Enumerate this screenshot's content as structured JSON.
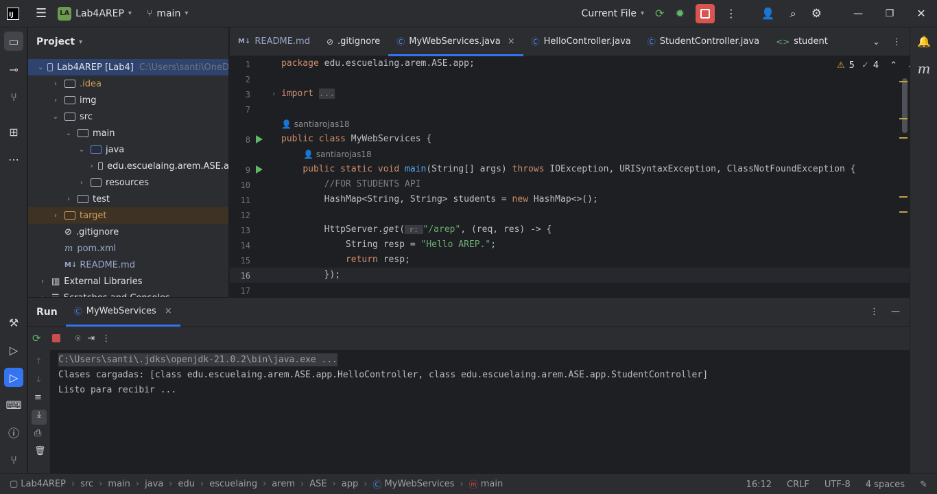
{
  "titlebar": {
    "logo_text": "IJ",
    "project_badge": "LA",
    "project_name": "Lab4AREP",
    "branch": "main",
    "run_config": "Current File"
  },
  "project_panel": {
    "title": "Project",
    "items": [
      {
        "label": "Lab4AREP [Lab4]",
        "path": "C:\\Users\\santi\\OneD",
        "indent": 0,
        "arrow": "down",
        "kind": "module",
        "selected": true
      },
      {
        "label": ".idea",
        "indent": 1,
        "arrow": "right",
        "kind": "folder",
        "color": "#d0a05a"
      },
      {
        "label": "img",
        "indent": 1,
        "arrow": "right",
        "kind": "folder"
      },
      {
        "label": "src",
        "indent": 1,
        "arrow": "down",
        "kind": "folder"
      },
      {
        "label": "main",
        "indent": 2,
        "arrow": "down",
        "kind": "folder"
      },
      {
        "label": "java",
        "indent": 3,
        "arrow": "down",
        "kind": "folder-blue"
      },
      {
        "label": "edu.escuelaing.arem.ASE.a",
        "indent": 4,
        "arrow": "right",
        "kind": "package"
      },
      {
        "label": "resources",
        "indent": 3,
        "arrow": "right",
        "kind": "folder"
      },
      {
        "label": "test",
        "indent": 2,
        "arrow": "right",
        "kind": "folder"
      },
      {
        "label": "target",
        "indent": 1,
        "arrow": "right",
        "kind": "folder-orange",
        "color": "#d0a05a",
        "target": true
      },
      {
        "label": ".gitignore",
        "indent": 1,
        "arrow": "",
        "kind": "gitignore"
      },
      {
        "label": "pom.xml",
        "indent": 1,
        "arrow": "",
        "kind": "maven",
        "color": "#9aa7c9"
      },
      {
        "label": "README.md",
        "indent": 1,
        "arrow": "",
        "kind": "md",
        "color": "#9aa7c9"
      },
      {
        "label": "External Libraries",
        "indent": 0,
        "arrow": "right",
        "kind": "library"
      },
      {
        "label": "Scratches and Consoles",
        "indent": 0,
        "arrow": "right",
        "kind": "scratch"
      }
    ]
  },
  "tabs": [
    {
      "label": "README.md",
      "icon": "M↓",
      "active": false,
      "color": "#9aa7c9"
    },
    {
      "label": ".gitignore",
      "icon": "⊘",
      "active": false
    },
    {
      "label": "MyWebServices.java",
      "icon": "Ⓒ",
      "active": true,
      "close": "×"
    },
    {
      "label": "HelloController.java",
      "icon": "Ⓒ",
      "active": false
    },
    {
      "label": "StudentController.java",
      "icon": "Ⓒ",
      "active": false
    },
    {
      "label": "student",
      "icon": "<>",
      "active": false
    }
  ],
  "editor": {
    "warnings": "5",
    "weak_warnings": "4",
    "authors": [
      "santiarojas18",
      "santiarojas18"
    ],
    "lines": [
      {
        "n": "1",
        "html": "<span class=\"kw\">package</span> edu.escuelaing.arem.ASE.app;"
      },
      {
        "n": "2",
        "html": ""
      },
      {
        "n": "3",
        "html": "<span class=\"kw\">import</span> <span style=\"background:#393b40;color:#7a7e85\">...</span>"
      },
      {
        "n": "7",
        "html": ""
      },
      {
        "n": "8",
        "html": "<span class=\"kw\">public class</span> MyWebServices {"
      },
      {
        "n": "9",
        "html": "    <span class=\"kw\">public static void</span> <span class=\"fn\">main</span>(String[] args) <span class=\"kw\">throws</span> IOException, URISyntaxException, ClassNotFoundException {"
      },
      {
        "n": "10",
        "html": "        <span class=\"cm\">//FOR STUDENTS API</span>"
      },
      {
        "n": "11",
        "html": "        HashMap&lt;String, String&gt; students = <span class=\"kw\">new</span> HashMap&lt;&gt;();"
      },
      {
        "n": "12",
        "html": ""
      },
      {
        "n": "13",
        "html": "        HttpServer.<span class=\"it\">get</span>(<span style=\"color:#8c8f94;font-size:11px;background:#393b40\"> r: </span><span class=\"str\">\"/arep\"</span>, (req, res) -&gt; {"
      },
      {
        "n": "14",
        "html": "            String resp = <span class=\"str\">\"Hello AREP.\"</span>;"
      },
      {
        "n": "15",
        "html": "            <span class=\"kw\">return</span> resp;"
      },
      {
        "n": "16",
        "html": "        });"
      },
      {
        "n": "17",
        "html": ""
      }
    ]
  },
  "run": {
    "title": "Run",
    "tab": "MyWebServices",
    "console": [
      "C:\\Users\\santi\\.jdks\\openjdk-21.0.2\\bin\\java.exe ...",
      "Clases cargadas: [class edu.escuelaing.arem.ASE.app.HelloController, class edu.escuelaing.arem.ASE.app.StudentController]",
      "Listo para recibir ..."
    ]
  },
  "statusbar": {
    "breadcrumbs": [
      "Lab4AREP",
      "src",
      "main",
      "java",
      "edu",
      "escuelaing",
      "arem",
      "ASE",
      "app",
      "MyWebServices",
      "main"
    ],
    "position": "16:12",
    "line_sep": "CRLF",
    "encoding": "UTF-8",
    "indent": "4 spaces"
  },
  "colors": {
    "accent": "#3574f0",
    "stop": "#d9534f",
    "run": "#5fb865"
  }
}
